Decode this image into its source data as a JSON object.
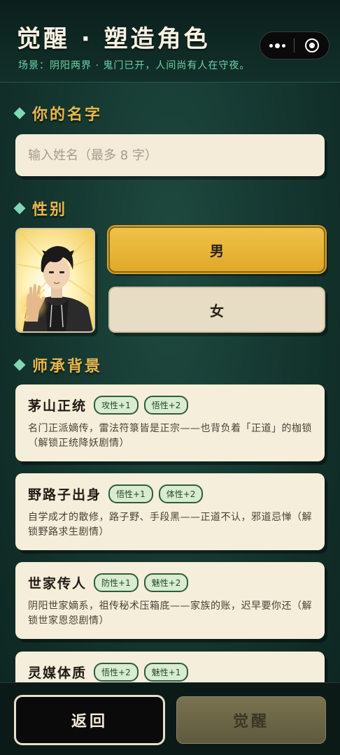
{
  "header": {
    "title": "觉醒 · 塑造角色",
    "subtitle": "场景：阴阳两界 · 鬼门已开，人间尚有人在守夜。"
  },
  "sections": {
    "name": "你的名字",
    "gender": "性别",
    "background": "师承背景"
  },
  "name_input": {
    "placeholder": "输入姓名（最多 8 字）",
    "value": ""
  },
  "gender": {
    "options": [
      "男",
      "女"
    ],
    "selected": "男"
  },
  "backgrounds": [
    {
      "title": "茅山正统",
      "badges": [
        "攻性+1",
        "悟性+2"
      ],
      "desc": "名门正派嫡传，雷法符箓皆是正宗——也背负着「正道」的枷锁（解锁正统降妖剧情）"
    },
    {
      "title": "野路子出身",
      "badges": [
        "悟性+1",
        "体性+2"
      ],
      "desc": "自学成才的散修，路子野、手段黑——正道不认，邪道忌惮（解锁野路求生剧情）"
    },
    {
      "title": "世家传人",
      "badges": [
        "防性+1",
        "魅性+2"
      ],
      "desc": "阴阳世家嫡系，祖传秘术压箱底——家族的账，迟早要你还（解锁世家恩怨剧情）"
    },
    {
      "title": "灵媒体质",
      "badges": [
        "悟性+2",
        "魅性+1"
      ],
      "desc": ""
    }
  ],
  "buttons": {
    "back": "返回",
    "awaken": "觉醒"
  },
  "colors": {
    "accent_gold": "#e8b84c",
    "accent_green": "#7fd9b6",
    "card_bg": "#f5eeda",
    "selected_button": "#e0a928"
  },
  "icons": [
    "more-dots-icon",
    "close-target-icon",
    "diamond-bullet-icon"
  ]
}
